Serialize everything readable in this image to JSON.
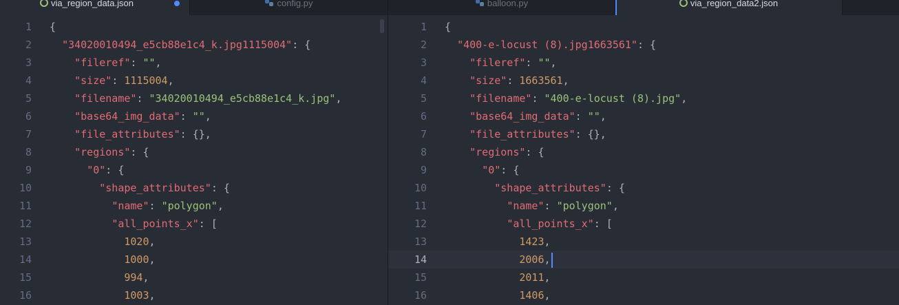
{
  "tabs": [
    {
      "label": "via_region_data.json",
      "icon": "json-icon",
      "active": true,
      "modified": true
    },
    {
      "label": "config.py",
      "icon": "python-icon",
      "active": false
    },
    {
      "label": "balloon.py",
      "icon": "python-icon",
      "active": false
    },
    {
      "label": "via_region_data2.json",
      "icon": "json-icon",
      "active": true
    }
  ],
  "left_pane": {
    "line_numbers": [
      "1",
      "2",
      "3",
      "4",
      "5",
      "6",
      "7",
      "8",
      "9",
      "10",
      "11",
      "12",
      "13",
      "14",
      "15",
      "16"
    ],
    "lines": [
      [
        "{"
      ],
      [
        "  ",
        "\"34020010494_e5cb88e1c4_k.jpg1115004\"",
        ": {"
      ],
      [
        "    ",
        "\"fileref\"",
        ": ",
        "\"\"",
        ","
      ],
      [
        "    ",
        "\"size\"",
        ": ",
        "1115004",
        ","
      ],
      [
        "    ",
        "\"filename\"",
        ": ",
        "\"34020010494_e5cb88e1c4_k.jpg\"",
        ","
      ],
      [
        "    ",
        "\"base64_img_data\"",
        ": ",
        "\"\"",
        ","
      ],
      [
        "    ",
        "\"file_attributes\"",
        ": {},"
      ],
      [
        "    ",
        "\"regions\"",
        ": {"
      ],
      [
        "      ",
        "\"0\"",
        ": {"
      ],
      [
        "        ",
        "\"shape_attributes\"",
        ": {"
      ],
      [
        "          ",
        "\"name\"",
        ": ",
        "\"polygon\"",
        ","
      ],
      [
        "          ",
        "\"all_points_x\"",
        ": ["
      ],
      [
        "            ",
        "1020",
        ","
      ],
      [
        "            ",
        "1000",
        ","
      ],
      [
        "            ",
        "994",
        ","
      ],
      [
        "            ",
        "1003",
        ","
      ]
    ]
  },
  "right_pane": {
    "line_numbers": [
      "1",
      "2",
      "3",
      "4",
      "5",
      "6",
      "7",
      "8",
      "9",
      "10",
      "11",
      "12",
      "13",
      "14",
      "15",
      "16"
    ],
    "cursor_line": 14,
    "lines": [
      [
        "{"
      ],
      [
        "  ",
        "\"400-e-locust (8).jpg1663561\"",
        ": {"
      ],
      [
        "    ",
        "\"fileref\"",
        ": ",
        "\"\"",
        ","
      ],
      [
        "    ",
        "\"size\"",
        ": ",
        "1663561",
        ","
      ],
      [
        "    ",
        "\"filename\"",
        ": ",
        "\"400-e-locust (8).jpg\"",
        ","
      ],
      [
        "    ",
        "\"base64_img_data\"",
        ": ",
        "\"\"",
        ","
      ],
      [
        "    ",
        "\"file_attributes\"",
        ": {},"
      ],
      [
        "    ",
        "\"regions\"",
        ": {"
      ],
      [
        "      ",
        "\"0\"",
        ": {"
      ],
      [
        "        ",
        "\"shape_attributes\"",
        ": {"
      ],
      [
        "          ",
        "\"name\"",
        ": ",
        "\"polygon\"",
        ","
      ],
      [
        "          ",
        "\"all_points_x\"",
        ": ["
      ],
      [
        "            ",
        "1423",
        ","
      ],
      [
        "            ",
        "2006",
        ","
      ],
      [
        "            ",
        "2011",
        ","
      ],
      [
        "            ",
        "1406",
        ","
      ]
    ]
  },
  "colors": {
    "background": "#282c34",
    "key": "#e06c75",
    "string": "#98c379",
    "number": "#d19a66",
    "accent": "#528bff"
  }
}
